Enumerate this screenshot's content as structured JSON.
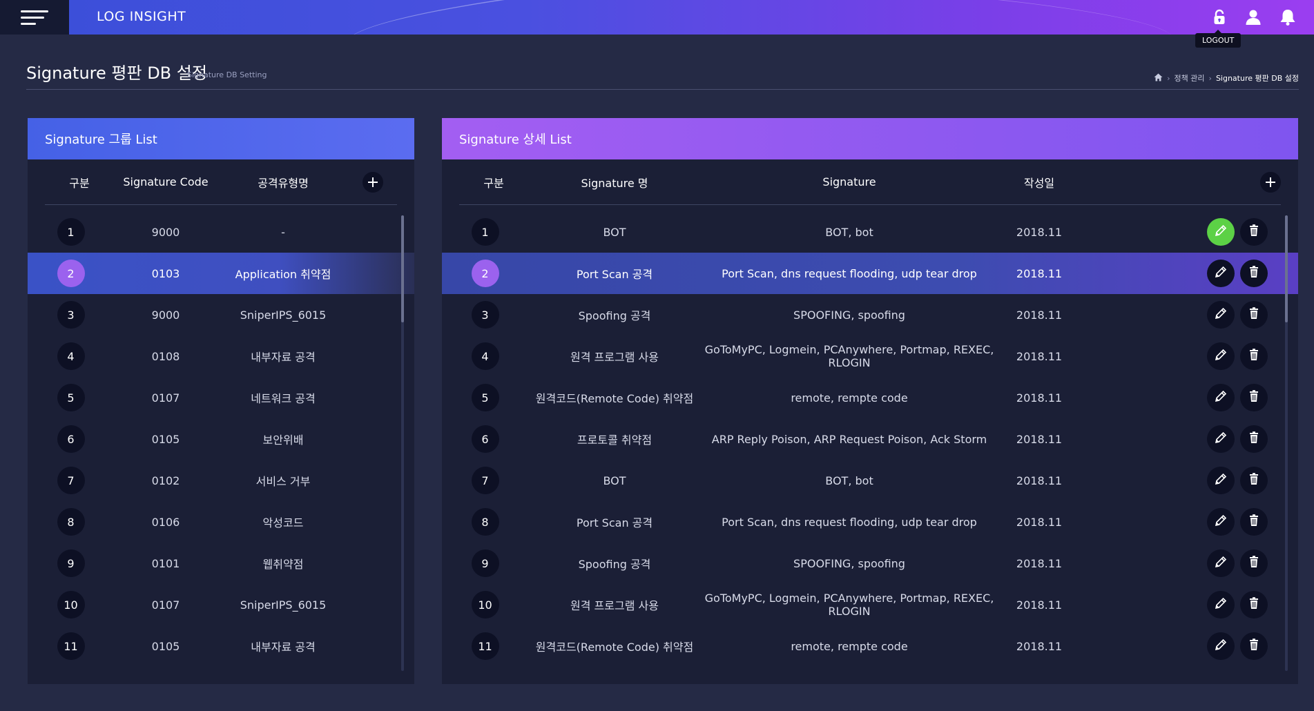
{
  "app": {
    "title": "LOG INSIGHT"
  },
  "header_icons": {
    "tooltip": "LOGOUT"
  },
  "page": {
    "title": "Signature 평판 DB 설정",
    "subtitle": "Signature DB Setting",
    "breadcrumb": [
      "정책 관리",
      "Signature 평판 DB 설정"
    ]
  },
  "group_panel": {
    "title": "Signature 그룹 List",
    "columns": [
      "구분",
      "Signature Code",
      "공격유형명"
    ],
    "rows": [
      {
        "no": "1",
        "code": "9000",
        "name": "-"
      },
      {
        "no": "2",
        "code": "0103",
        "name": "Application 취약점"
      },
      {
        "no": "3",
        "code": "9000",
        "name": "SniperIPS_6015"
      },
      {
        "no": "4",
        "code": "0108",
        "name": "내부자료 공격"
      },
      {
        "no": "5",
        "code": "0107",
        "name": "네트워크 공격"
      },
      {
        "no": "6",
        "code": "0105",
        "name": "보안위배"
      },
      {
        "no": "7",
        "code": "0102",
        "name": "서비스 거부"
      },
      {
        "no": "8",
        "code": "0106",
        "name": "악성코드"
      },
      {
        "no": "9",
        "code": "0101",
        "name": "웹취약점"
      },
      {
        "no": "10",
        "code": "0107",
        "name": "SniperIPS_6015"
      },
      {
        "no": "11",
        "code": "0105",
        "name": "내부자료 공격"
      }
    ],
    "selected_index": 1
  },
  "detail_panel": {
    "title": "Signature 상세 List",
    "columns": [
      "구분",
      "Signature 명",
      "Signature",
      "작성일"
    ],
    "rows": [
      {
        "no": "1",
        "name": "BOT",
        "signature": "BOT, bot",
        "date": "2018.11"
      },
      {
        "no": "2",
        "name": "Port Scan 공격",
        "signature": "Port Scan, dns request flooding, udp tear drop",
        "date": "2018.11"
      },
      {
        "no": "3",
        "name": "Spoofing 공격",
        "signature": "SPOOFING, spoofing",
        "date": "2018.11"
      },
      {
        "no": "4",
        "name": "원격 프로그램 사용",
        "signature": "GoToMyPC, Logmein, PCAnywhere, Portmap, REXEC, RLOGIN",
        "date": "2018.11"
      },
      {
        "no": "5",
        "name": "원격코드(Remote Code) 취약점",
        "signature": "remote, rempte code",
        "date": "2018.11"
      },
      {
        "no": "6",
        "name": "프로토콜 취약점",
        "signature": "ARP Reply Poison, ARP Request Poison, Ack Storm",
        "date": "2018.11"
      },
      {
        "no": "7",
        "name": "BOT",
        "signature": "BOT, bot",
        "date": "2018.11"
      },
      {
        "no": "8",
        "name": "Port Scan 공격",
        "signature": "Port Scan, dns request flooding, udp tear drop",
        "date": "2018.11"
      },
      {
        "no": "9",
        "name": "Spoofing 공격",
        "signature": "SPOOFING, spoofing",
        "date": "2018.11"
      },
      {
        "no": "10",
        "name": "원격 프로그램 사용",
        "signature": "GoToMyPC, Logmein, PCAnywhere, Portmap, REXEC, RLOGIN",
        "date": "2018.11"
      },
      {
        "no": "11",
        "name": "원격코드(Remote Code) 취약점",
        "signature": "remote, rempte code",
        "date": "2018.11"
      }
    ],
    "selected_index": 1
  },
  "colors": {
    "accent_blue": "#4561e6",
    "accent_purple": "#a35ef2",
    "selected_badge": "#9b62ee",
    "edit_active": "#5cd146",
    "background": "#252a45"
  }
}
